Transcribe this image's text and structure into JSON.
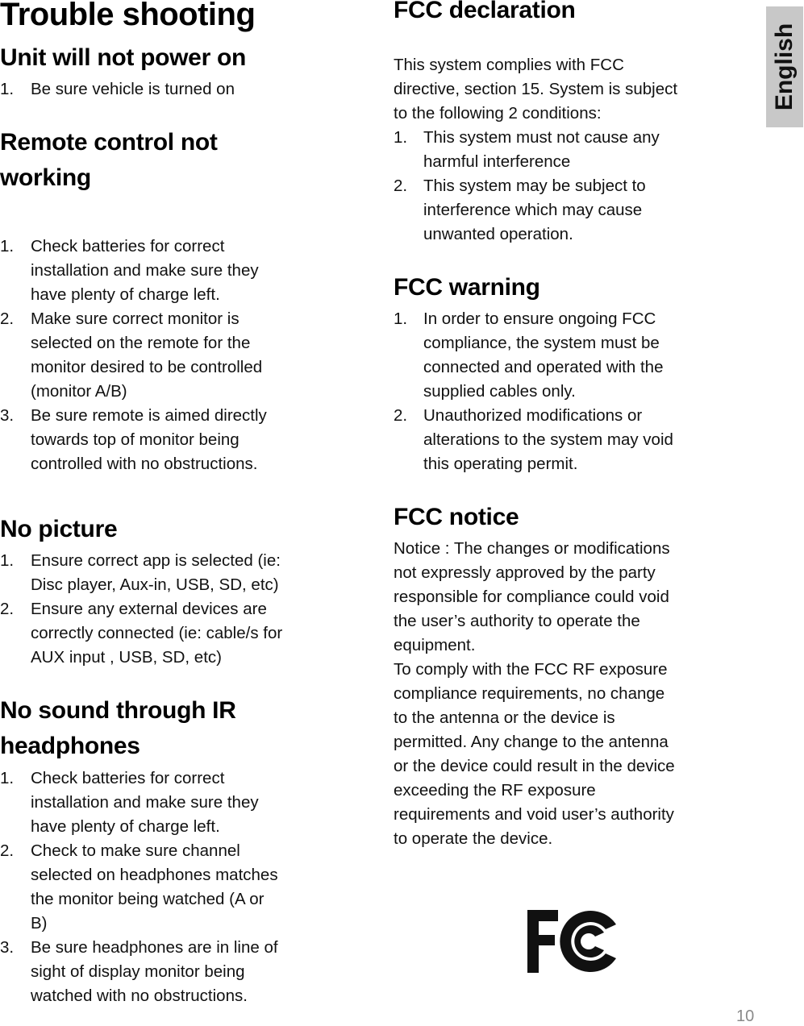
{
  "language_tab": "English",
  "page_number": "10",
  "left_column": {
    "title": "Trouble shooting",
    "sections": [
      {
        "heading_lines": [
          "Unit will not power on"
        ],
        "items": [
          {
            "num": "1.",
            "lines": [
              "Be sure vehicle is turned on"
            ]
          }
        ]
      },
      {
        "heading_lines": [
          "Remote control not",
          "working"
        ],
        "items": [
          {
            "num": "1.",
            "lines": [
              "Check batteries for correct",
              "installation and make sure they",
              "have  plenty of charge left."
            ]
          },
          {
            "num": "2.",
            "lines": [
              "Make sure correct monitor is",
              "selected on the remote for the",
              "monitor desired to be controlled",
              "(monitor A/B)"
            ]
          },
          {
            "num": "3.",
            "lines": [
              "Be sure remote is aimed directly",
              "towards top of monitor being",
              "controlled with no obstructions."
            ]
          }
        ]
      },
      {
        "heading_lines": [
          "No picture"
        ],
        "items": [
          {
            "num": "1.",
            "lines": [
              "Ensure correct app is selected (ie:",
              "Disc player, Aux-in, USB, SD, etc)"
            ]
          },
          {
            "num": "2.",
            "lines": [
              "Ensure any external devices are",
              "correctly connected (ie: cable/s for",
              "AUX input , USB, SD, etc)"
            ]
          }
        ]
      },
      {
        "heading_lines": [
          "No sound through IR",
          "headphones"
        ],
        "items": [
          {
            "num": "1.",
            "lines": [
              "Check batteries for correct",
              "installation and make sure they",
              "have  plenty of charge left."
            ]
          },
          {
            "num": "2.",
            "lines": [
              "Check to make sure channel",
              "selected on headphones matches",
              "the monitor being watched (A or",
              "B)"
            ]
          },
          {
            "num": "3.",
            "lines": [
              "Be sure headphones are in line of",
              "sight of display monitor being",
              "watched with no obstructions."
            ]
          }
        ]
      }
    ]
  },
  "right_column": {
    "fcc_declaration": {
      "heading": "FCC declaration",
      "intro_lines": [
        "This system complies with FCC",
        "directive, section 15. System is subject",
        "to the following 2 conditions:"
      ],
      "items": [
        {
          "num": "1.",
          "lines": [
            "This system must not cause any",
            "harmful interference"
          ]
        },
        {
          "num": "2.",
          "lines": [
            "This system may be subject to",
            "interference which may cause",
            "unwanted operation."
          ]
        }
      ]
    },
    "fcc_warning": {
      "heading": "FCC warning",
      "items": [
        {
          "num": "1.",
          "lines": [
            "In order to ensure ongoing FCC",
            "compliance, the system must be",
            "connected and operated with the",
            "supplied cables only."
          ]
        },
        {
          "num": "2.",
          "lines": [
            "Unauthorized modifications or",
            "alterations to the system may void",
            "this operating permit."
          ]
        }
      ]
    },
    "fcc_notice": {
      "heading": "FCC notice",
      "lines": [
        "Notice : The changes or modifications",
        "not expressly approved by the party",
        "responsible for compliance could void",
        "the user’s authority to operate the",
        "equipment.",
        "To comply with the FCC RF exposure",
        "compliance requirements, no change",
        "to the antenna or the device is",
        "permitted. Any change to the antenna",
        "or the device could result in the device",
        "exceeding the RF exposure",
        "requirements and void user’s authority",
        "to operate the device."
      ]
    },
    "logo": "fcc-logo"
  }
}
